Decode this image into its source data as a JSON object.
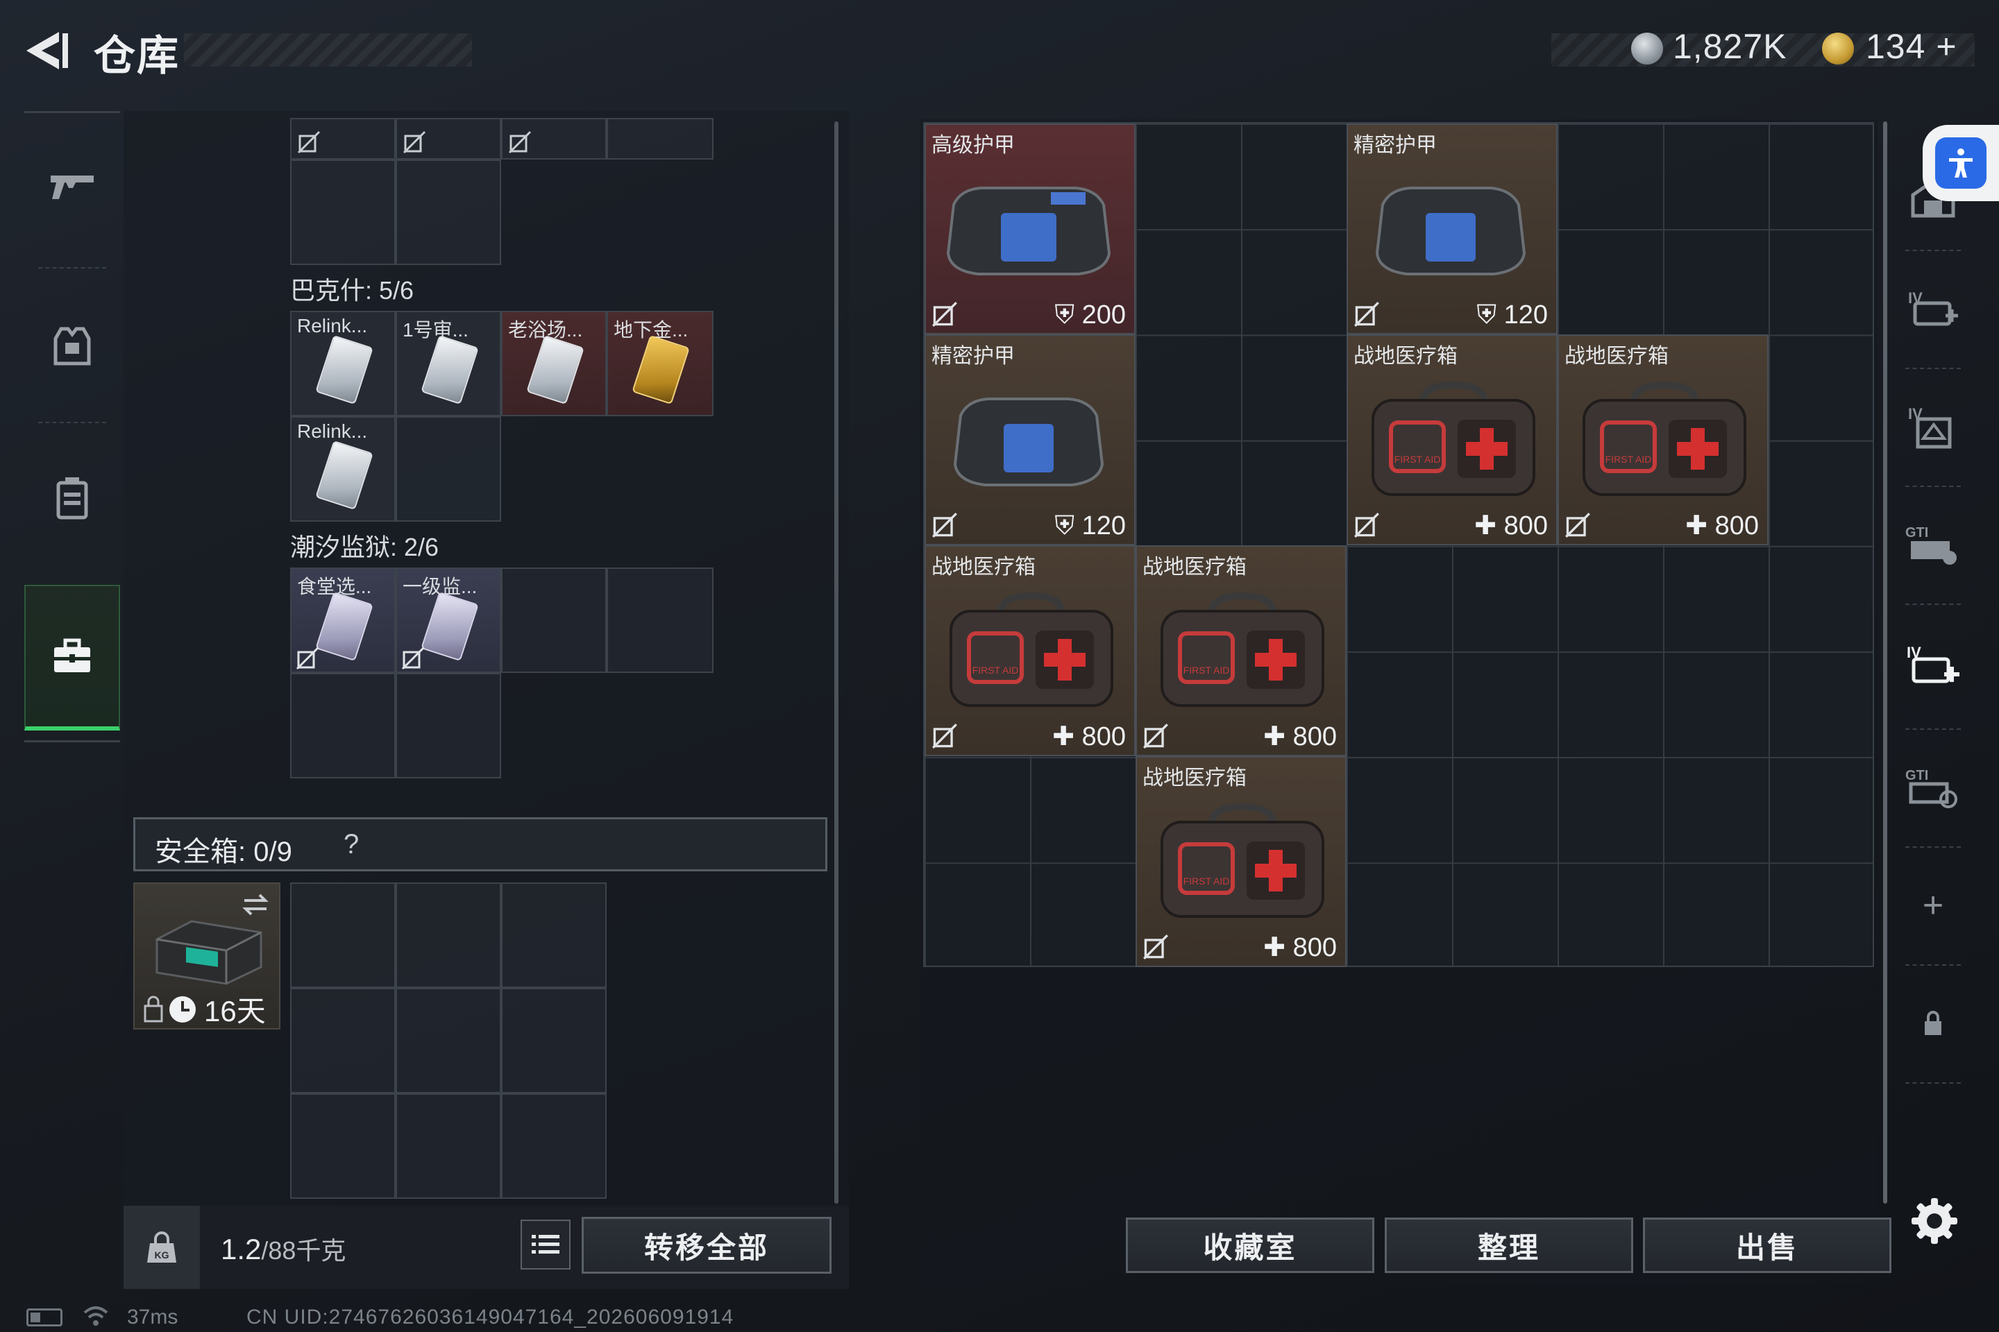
{
  "header": {
    "title": "仓库"
  },
  "currency": {
    "silver": "1,827K",
    "gold": "134",
    "gold_plus": "+"
  },
  "left_panel": {
    "section_bakesh": {
      "label": "巴克什: 5/6",
      "items": [
        {
          "name": "Relink...",
          "card": "silver"
        },
        {
          "name": "1号审...",
          "card": "silver"
        },
        {
          "name": "老浴场...",
          "card": "silver"
        },
        {
          "name": "地下金...",
          "card": "gold"
        },
        {
          "name": "Relink...",
          "card": "silver"
        }
      ]
    },
    "section_prison": {
      "label": "潮汐监狱: 2/6",
      "items": [
        {
          "name": "食堂选...",
          "card": "purple"
        },
        {
          "name": "一级监...",
          "card": "purple"
        }
      ]
    },
    "safe_box": {
      "label": "安全箱: 0/9",
      "help": "?",
      "days": "16天"
    },
    "weight": {
      "current": "1.2",
      "max": "/88千克",
      "lock_text": "KG"
    },
    "transfer_all": "转移全部"
  },
  "stash": {
    "items": [
      {
        "name": "高级护甲",
        "value": "200",
        "type": "armor",
        "rarity": "red",
        "stat_icon": "shield-icon"
      },
      {
        "name": "精密护甲",
        "value": "120",
        "type": "armor",
        "rarity": "brown",
        "stat_icon": "shield-icon"
      },
      {
        "name": "精密护甲",
        "value": "120",
        "type": "armor",
        "rarity": "brown",
        "stat_icon": "shield-icon"
      },
      {
        "name": "战地医疗箱",
        "value": "800",
        "type": "medkit",
        "stat_icon": "plus-icon"
      },
      {
        "name": "战地医疗箱",
        "value": "800",
        "type": "medkit",
        "stat_icon": "plus-icon"
      },
      {
        "name": "战地医疗箱",
        "value": "800",
        "type": "medkit",
        "stat_icon": "plus-icon"
      },
      {
        "name": "战地医疗箱",
        "value": "800",
        "type": "medkit",
        "stat_icon": "plus-icon"
      },
      {
        "name": "战地医疗箱",
        "value": "800",
        "type": "medkit",
        "stat_icon": "plus-icon"
      }
    ],
    "medkit_text": "FIRST AID"
  },
  "right_nav": {
    "labels": [
      "IV",
      "IV",
      "GTI",
      "IV",
      "GTI"
    ],
    "plus": "+"
  },
  "buttons": {
    "collection": "收藏室",
    "sort": "整理",
    "sell": "出售"
  },
  "status": {
    "ping": "37ms",
    "uid": "CN UID:2746762603614904716‬4_202606091914"
  },
  "colors": {
    "accent_green": "#3bd06a",
    "rarity_red": "#5a2f33",
    "rarity_brown": "#4b3f34"
  }
}
